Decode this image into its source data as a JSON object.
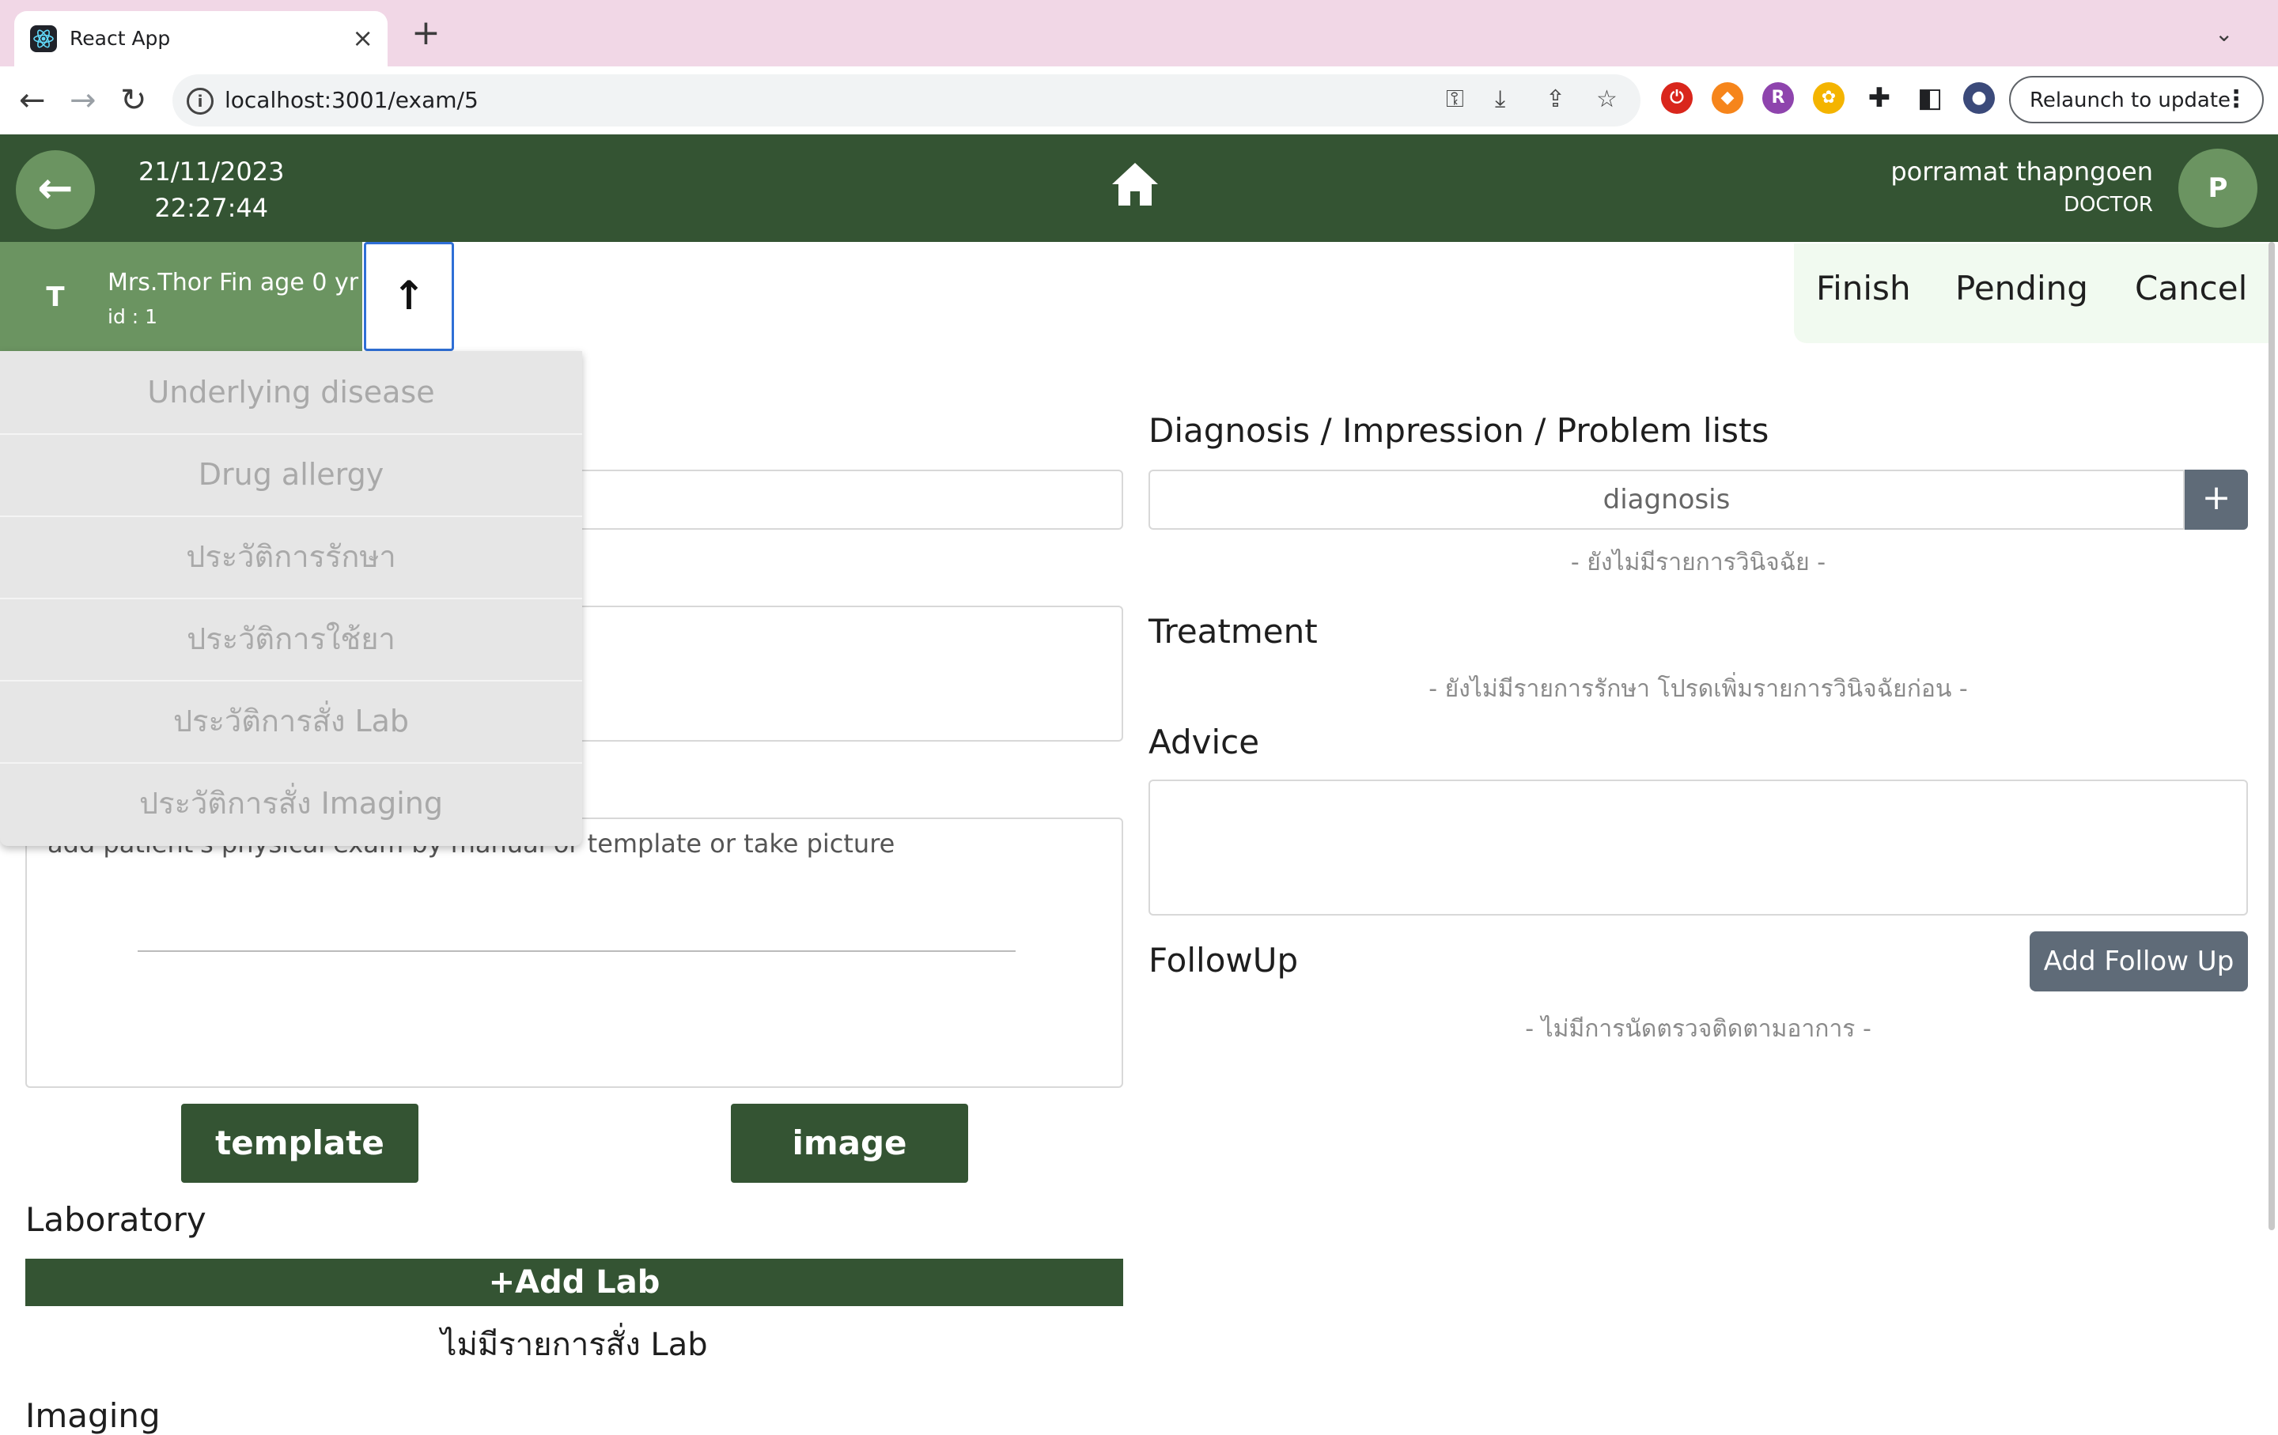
{
  "browser": {
    "tab_title": "React App",
    "close_glyph": "×",
    "new_tab_glyph": "+",
    "tab_menu_glyph": "⌄",
    "url": "localhost:3001/exam/5",
    "relaunch_label": "Relaunch to update",
    "menu_glyph": "⋮",
    "back_glyph": "←",
    "forward_glyph": "→",
    "reload_glyph": "↻"
  },
  "header": {
    "back_glyph": "←",
    "date": "21/11/2023",
    "time": "22:27:44",
    "user_name": "porramat thapngoen",
    "user_role": "DOCTOR",
    "user_initial": "P",
    "bar_color": "#345433",
    "accent_color": "#6b9461"
  },
  "patient": {
    "initial": "T",
    "name": "Mrs.Thor Fin age 0 yr",
    "id_label": "id : 1",
    "collapse_glyph": "↑"
  },
  "actions": {
    "finish": "Finish",
    "pending": "Pending",
    "cancel": "Cancel"
  },
  "dropdown": {
    "items": [
      "Underlying disease",
      "Drug allergy",
      "ประวัติการรักษา",
      "ประวัติการใช้ยา",
      "ประวัติการสั่ง Lab",
      "ประวัติการสั่ง Imaging"
    ]
  },
  "physical_exam": {
    "placeholder_text": "add patient's physical exam by manual or template or take picture",
    "template_button": "template",
    "image_button": "image"
  },
  "laboratory": {
    "title": "Laboratory",
    "add_button": "+Add Lab",
    "empty_text": "ไม่มีรายการสั่ง Lab"
  },
  "imaging": {
    "title": "Imaging"
  },
  "diagnosis": {
    "title": "Diagnosis / Impression / Problem lists",
    "placeholder": "diagnosis",
    "add_glyph": "+",
    "empty_text": "- ยังไม่มีรายการวินิจฉัย -"
  },
  "treatment": {
    "title": "Treatment",
    "empty_text": "- ยังไม่มีรายการรักษา โปรดเพิ่มรายการวินิจฉัยก่อน -"
  },
  "advice": {
    "title": "Advice"
  },
  "followup": {
    "title": "FollowUp",
    "add_button": "Add Follow Up",
    "empty_text": "- ไม่มีการนัดตรวจติดตามอาการ -"
  }
}
